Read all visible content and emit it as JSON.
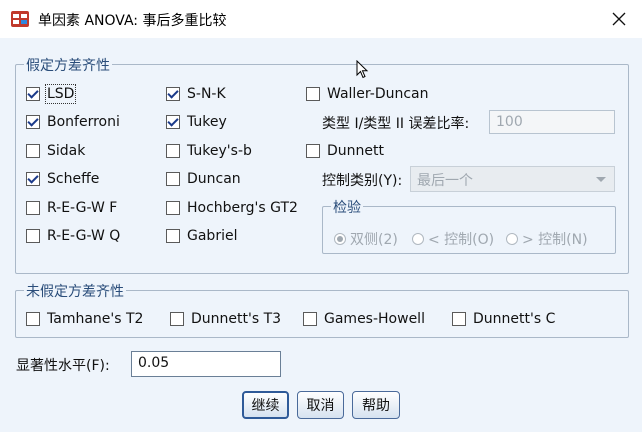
{
  "window": {
    "title": "单因素 ANOVA: 事后多重比较",
    "icon": "anova-app-icon",
    "close_icon": "close-icon"
  },
  "equal_variances": {
    "group_title": "假定方差齐性",
    "checkboxes": [
      {
        "label": "LSD",
        "checked": true
      },
      {
        "label": "Bonferroni",
        "checked": true
      },
      {
        "label": "Sidak",
        "checked": false
      },
      {
        "label": "Scheffe",
        "checked": true
      },
      {
        "label": "R-E-G-W F",
        "checked": false
      },
      {
        "label": "R-E-G-W Q",
        "checked": false
      },
      {
        "label": "S-N-K",
        "checked": true
      },
      {
        "label": "Tukey",
        "checked": true
      },
      {
        "label": "Tukey's-b",
        "checked": false
      },
      {
        "label": "Duncan",
        "checked": false
      },
      {
        "label": "Hochberg's GT2",
        "checked": false
      },
      {
        "label": "Gabriel",
        "checked": false
      },
      {
        "label": "Waller-Duncan",
        "checked": false
      },
      {
        "label": "Dunnett",
        "checked": false
      }
    ],
    "error_ratio_label": "类型 I/类型 II 误差比率:",
    "error_ratio_value": "100",
    "control_category_label": "控制类别(Y):",
    "control_category_value": "最后一个",
    "test_group_title": "检验",
    "test_options": [
      {
        "label": "双侧(2)",
        "selected": true
      },
      {
        "label": "< 控制(O)",
        "selected": false
      },
      {
        "label": "> 控制(N)",
        "selected": false
      }
    ]
  },
  "unequal_variances": {
    "group_title": "未假定方差齐性",
    "checkboxes": [
      {
        "label": "Tamhane's T2",
        "checked": false
      },
      {
        "label": "Dunnett's T3",
        "checked": false
      },
      {
        "label": "Games-Howell",
        "checked": false
      },
      {
        "label": "Dunnett's C",
        "checked": false
      }
    ]
  },
  "significance": {
    "label": "显著性水平(F):",
    "value": "0.05"
  },
  "buttons": {
    "continue": "继续",
    "cancel": "取消",
    "help": "帮助"
  }
}
